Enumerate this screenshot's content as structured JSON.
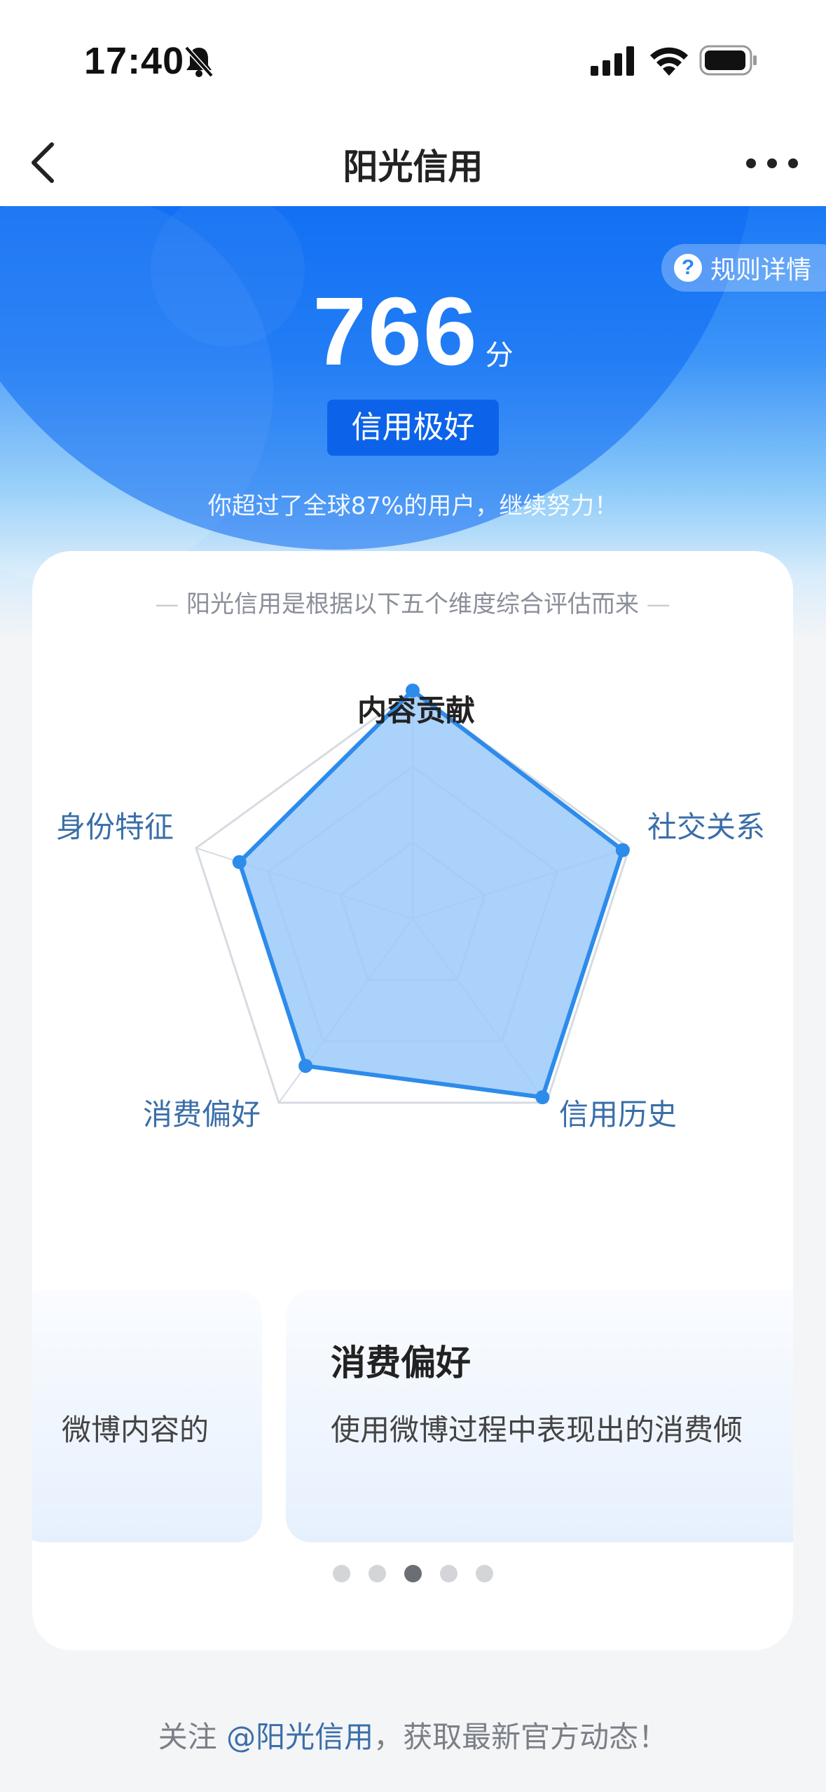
{
  "status_bar": {
    "time": "17:40"
  },
  "nav": {
    "title": "阳光信用"
  },
  "hero": {
    "rule_label": "规则详情",
    "score": "766",
    "score_unit": "分",
    "level": "信用极好",
    "rank_text": "你超过了全球87%的用户，继续努力！"
  },
  "card": {
    "subtitle": "阳光信用是根据以下五个维度综合评估而来",
    "dimensions": [
      "内容贡献",
      "社交关系",
      "信用历史",
      "消费偏好",
      "身份特征"
    ],
    "radar_values": [
      1.0,
      0.97,
      0.97,
      0.8,
      0.8
    ],
    "colors": {
      "fill": "#9ccaf9",
      "stroke": "#2d8bea",
      "grid": "#d6dbe2"
    },
    "slides": {
      "prev_desc": "微博内容的",
      "current_title": "消费偏好",
      "current_desc": "使用微博过程中表现出的消费倾"
    },
    "pager": {
      "count": 5,
      "active": 2
    }
  },
  "footer": {
    "prefix": "关注 ",
    "mention": "@阳光信用",
    "suffix": "，获取最新官方动态！"
  }
}
